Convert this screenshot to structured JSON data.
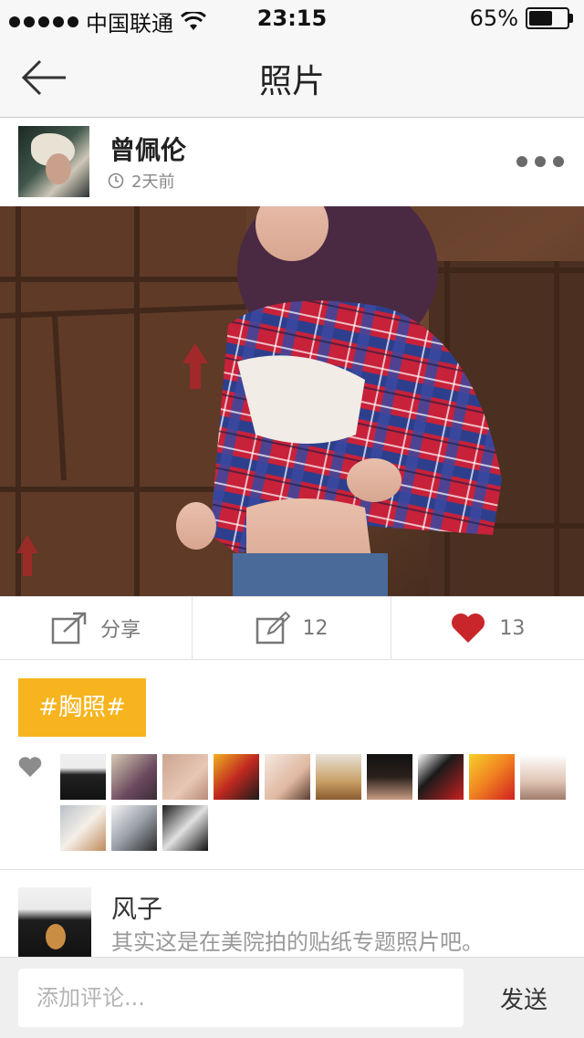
{
  "status_bar": {
    "carrier": "中国联通",
    "time": "23:15",
    "battery": "65%",
    "battery_level": 0.65
  },
  "nav": {
    "back_icon": "arrow-left-icon",
    "title": "照片"
  },
  "post": {
    "author": {
      "name": "曾佩伦",
      "time": "2天前"
    },
    "more_icon": "more-dots-icon"
  },
  "actions": {
    "share_label": "分享",
    "comment_count": "12",
    "like_count": "13"
  },
  "tag": "#胸照#",
  "likers_count": 13,
  "comments": [
    {
      "name": "风子",
      "text": "其实这是在美院拍的贴纸专题照片吧。"
    }
  ],
  "input": {
    "placeholder": "添加评论...",
    "send_label": "发送"
  },
  "colors": {
    "accent_yellow": "#f7b41e",
    "like_red": "#c8262b",
    "nav_bg": "#f7f7f7"
  }
}
